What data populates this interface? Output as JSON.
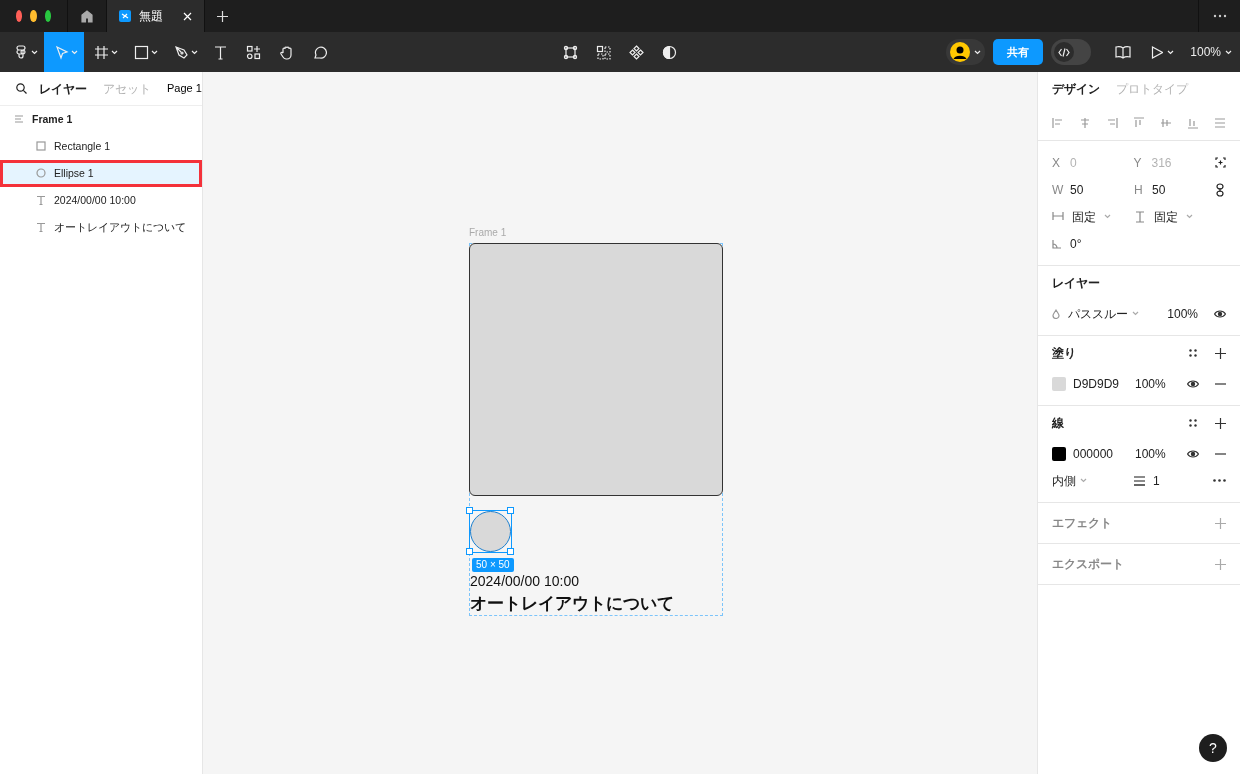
{
  "title_bar": {
    "tabs": [
      {
        "kind": "home",
        "selected": false
      },
      {
        "kind": "file",
        "label": "無題",
        "selected": true
      }
    ]
  },
  "toolbar": {
    "left_tools": [
      {
        "kind": "main-menu",
        "selected": false,
        "caret": true
      },
      {
        "kind": "move",
        "selected": true,
        "caret": true
      },
      {
        "kind": "frame",
        "selected": false,
        "caret": true
      },
      {
        "kind": "shape",
        "selected": false,
        "caret": true
      },
      {
        "kind": "pen",
        "selected": false,
        "caret": true
      },
      {
        "kind": "text",
        "selected": false,
        "caret": false
      },
      {
        "kind": "resources",
        "selected": false,
        "caret": false
      },
      {
        "kind": "hand",
        "selected": false,
        "caret": false
      },
      {
        "kind": "comment",
        "selected": false,
        "caret": false
      }
    ],
    "center_tools": [
      {
        "kind": "frame-selection"
      },
      {
        "kind": "grid"
      },
      {
        "kind": "component"
      },
      {
        "kind": "contrast"
      }
    ],
    "share_button": "共有",
    "dev_mode": {
      "on": false
    },
    "zoom": "100%"
  },
  "left_panel": {
    "tabs": [
      {
        "label": "レイヤー",
        "selected": true
      },
      {
        "label": "アセット",
        "selected": false
      }
    ],
    "page": "Page 1",
    "layers": [
      {
        "name": "Frame 1",
        "kind": "frame",
        "selected": false,
        "annotated": false,
        "children": [
          {
            "name": "Rectangle 1",
            "kind": "rectangle",
            "selected": false,
            "annotated": false
          },
          {
            "name": "Ellipse 1",
            "kind": "ellipse",
            "selected": true,
            "annotated": true
          },
          {
            "name": "2024/00/00 10:00",
            "kind": "text",
            "selected": false,
            "annotated": false
          },
          {
            "name": "オートレイアウトについて",
            "kind": "text",
            "selected": false,
            "annotated": false
          }
        ]
      }
    ]
  },
  "canvas": {
    "frame_label": "Frame 1",
    "size_badge": "50 × 50",
    "date_text": "2024/00/00 10:00",
    "title_text": "オートレイアウトについて"
  },
  "right_panel": {
    "tabs": [
      {
        "label": "デザイン",
        "selected": true
      },
      {
        "label": "プロトタイプ",
        "selected": false
      }
    ],
    "position": [
      {
        "label": "X",
        "value": "0",
        "disabled": true
      },
      {
        "label": "Y",
        "value": "316",
        "disabled": true
      }
    ],
    "size": [
      {
        "label": "W",
        "value": "50",
        "disabled": false
      },
      {
        "label": "H",
        "value": "50",
        "disabled": false
      }
    ],
    "sizing": [
      "固定",
      "固定"
    ],
    "rotation": "0°",
    "layer": {
      "title": "レイヤー",
      "blend": "パススルー",
      "opacity": "100%"
    },
    "fill": {
      "title": "塗り",
      "color": "#d9d9d9",
      "hex": "D9D9D9",
      "opacity": "100%"
    },
    "stroke": {
      "title": "線",
      "color": "#000000",
      "hex": "000000",
      "opacity": "100%",
      "position": "内側",
      "weight": "1"
    },
    "effects": "エフェクト",
    "export": "エクスポート"
  },
  "help": "?"
}
